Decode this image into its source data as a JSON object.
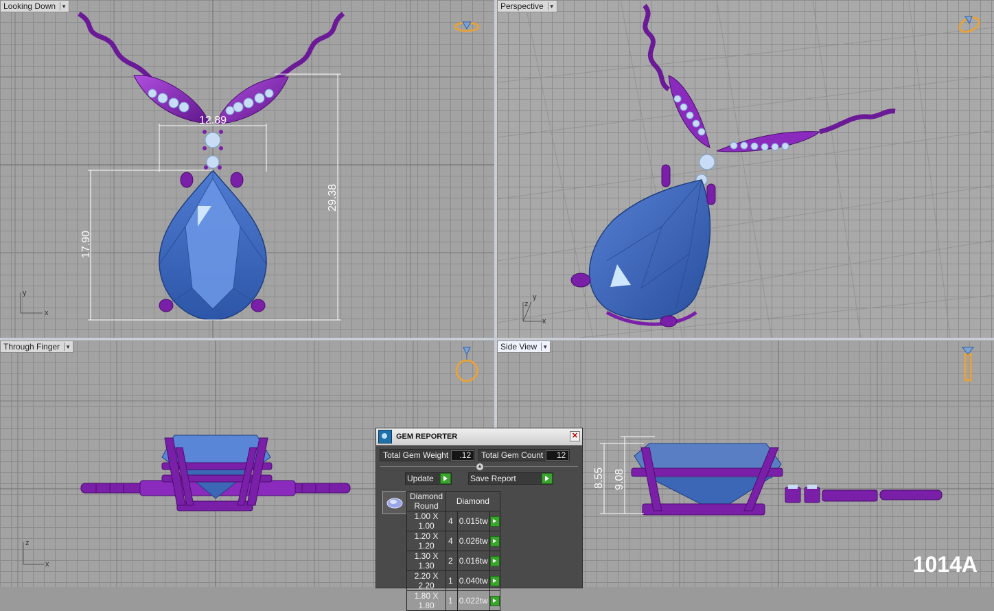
{
  "viewports": {
    "top_left": {
      "label": "Looking Down",
      "dims": {
        "width": "12.89",
        "height_left": "17.90",
        "height_right": "29.38"
      },
      "axes": {
        "x": "x",
        "y": "y"
      }
    },
    "top_right": {
      "label": "Perspective",
      "axes": {
        "x": "x",
        "y": "y",
        "z": "z"
      }
    },
    "bottom_left": {
      "label": "Through Finger",
      "axes": {
        "x": "x",
        "z": "z"
      }
    },
    "bottom_right": {
      "label": "Side View",
      "dims": {
        "left": "8.55",
        "right": "9.08"
      }
    }
  },
  "gem_reporter": {
    "title": "GEM REPORTER",
    "close": "✕",
    "total_weight_label": "Total Gem Weight",
    "total_weight_value": ".12",
    "total_count_label": "Total Gem Count",
    "total_count_value": "12",
    "update_label": "Update",
    "save_report_label": "Save Report",
    "columns": [
      "Diamond Round",
      "Diamond"
    ],
    "rows": [
      {
        "size": "1.00 X 1.00",
        "count": "4",
        "weight": "0.015tw"
      },
      {
        "size": "1.20 X 1.20",
        "count": "4",
        "weight": "0.026tw"
      },
      {
        "size": "1.30 X 1.30",
        "count": "2",
        "weight": "0.016tw"
      },
      {
        "size": "2.20 X 2.20",
        "count": "1",
        "weight": "0.040tw"
      },
      {
        "size": "1.80 X 1.80",
        "count": "1",
        "weight": "0.022tw"
      }
    ]
  },
  "model_id": "1014A",
  "colors": {
    "metal": "#7a1fa8",
    "gem": "#3c66b6",
    "pearl": "#c8dcf5",
    "accent_icon": "#e6a23c",
    "dim": "#ffffff"
  }
}
